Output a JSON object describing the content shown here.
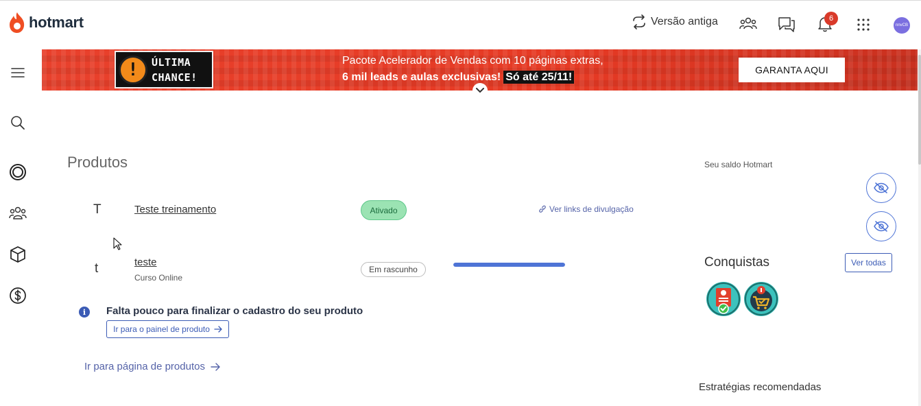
{
  "header": {
    "logo_text": "hotmart",
    "old_version_label": "Versão antiga",
    "notifications_count": "6",
    "avatar_text": "nnvCB"
  },
  "banner": {
    "chance_line1": "ÚLTIMA",
    "chance_line2": "CHANCE!",
    "line1": "Pacote Acelerador de Vendas com 10 páginas extras,",
    "line2": "6 mil leads e aulas exclusivas!",
    "highlight": "Só até 25/11!",
    "button_label": "GARANTA AQUI",
    "color": "#e8412c"
  },
  "main": {
    "title": "Produtos",
    "products": [
      {
        "letter": "T",
        "name": "Teste treinamento",
        "subtitle": "",
        "status": "Ativado",
        "link": "Ver links de divulgação"
      },
      {
        "letter": "t",
        "name": "teste",
        "subtitle": "Curso Online",
        "status": "Em rascunho",
        "progress": 1.0
      }
    ],
    "notice_title": "Falta pouco para finalizar o cadastro do seu produto",
    "notice_button": "Ir para o painel de produto",
    "products_link": "Ir para página de produtos"
  },
  "right": {
    "balance_label": "Seu saldo Hotmart",
    "achievements_title": "Conquistas",
    "see_all": "Ver todas",
    "strategies_title": "Estratégias recomendadas"
  }
}
